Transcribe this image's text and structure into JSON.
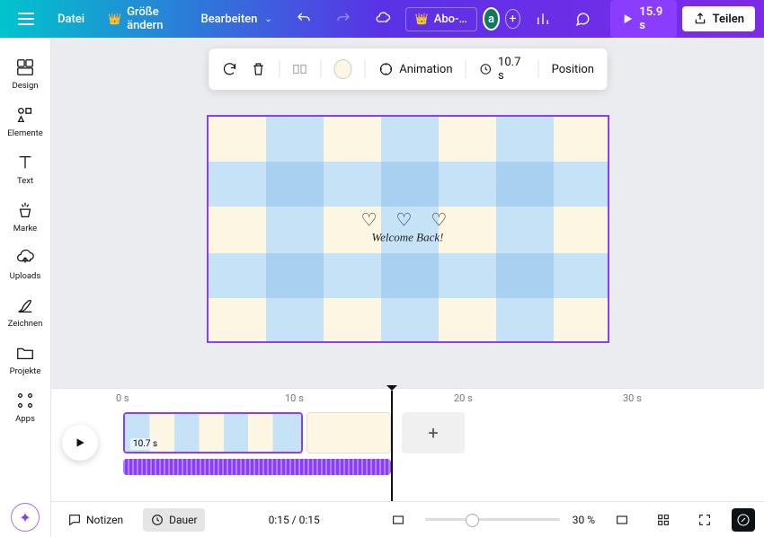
{
  "header": {
    "file": "Datei",
    "resize": "Größe ändern",
    "edit": "Bearbeiten",
    "abo": "Abo-…",
    "avatar": "a",
    "duration": "15.9 s",
    "share": "Teilen"
  },
  "sidebar": {
    "items": [
      {
        "label": "Design"
      },
      {
        "label": "Elemente"
      },
      {
        "label": "Text"
      },
      {
        "label": "Marke"
      },
      {
        "label": "Uploads"
      },
      {
        "label": "Zeichnen"
      },
      {
        "label": "Projekte"
      },
      {
        "label": "Apps"
      }
    ]
  },
  "toolbar": {
    "animation": "Animation",
    "page_time": "10.7 s",
    "position": "Position",
    "color": "#fdf6e3"
  },
  "canvas": {
    "welcome": "Welcome Back!"
  },
  "timeline": {
    "ticks": [
      "0 s",
      "10 s",
      "20 s",
      "30 s"
    ],
    "clip_time": "10.7 s",
    "playhead_time": "0:15 / 0:15"
  },
  "bottombar": {
    "notes": "Notizen",
    "duration": "Dauer",
    "zoom": "30 %"
  }
}
